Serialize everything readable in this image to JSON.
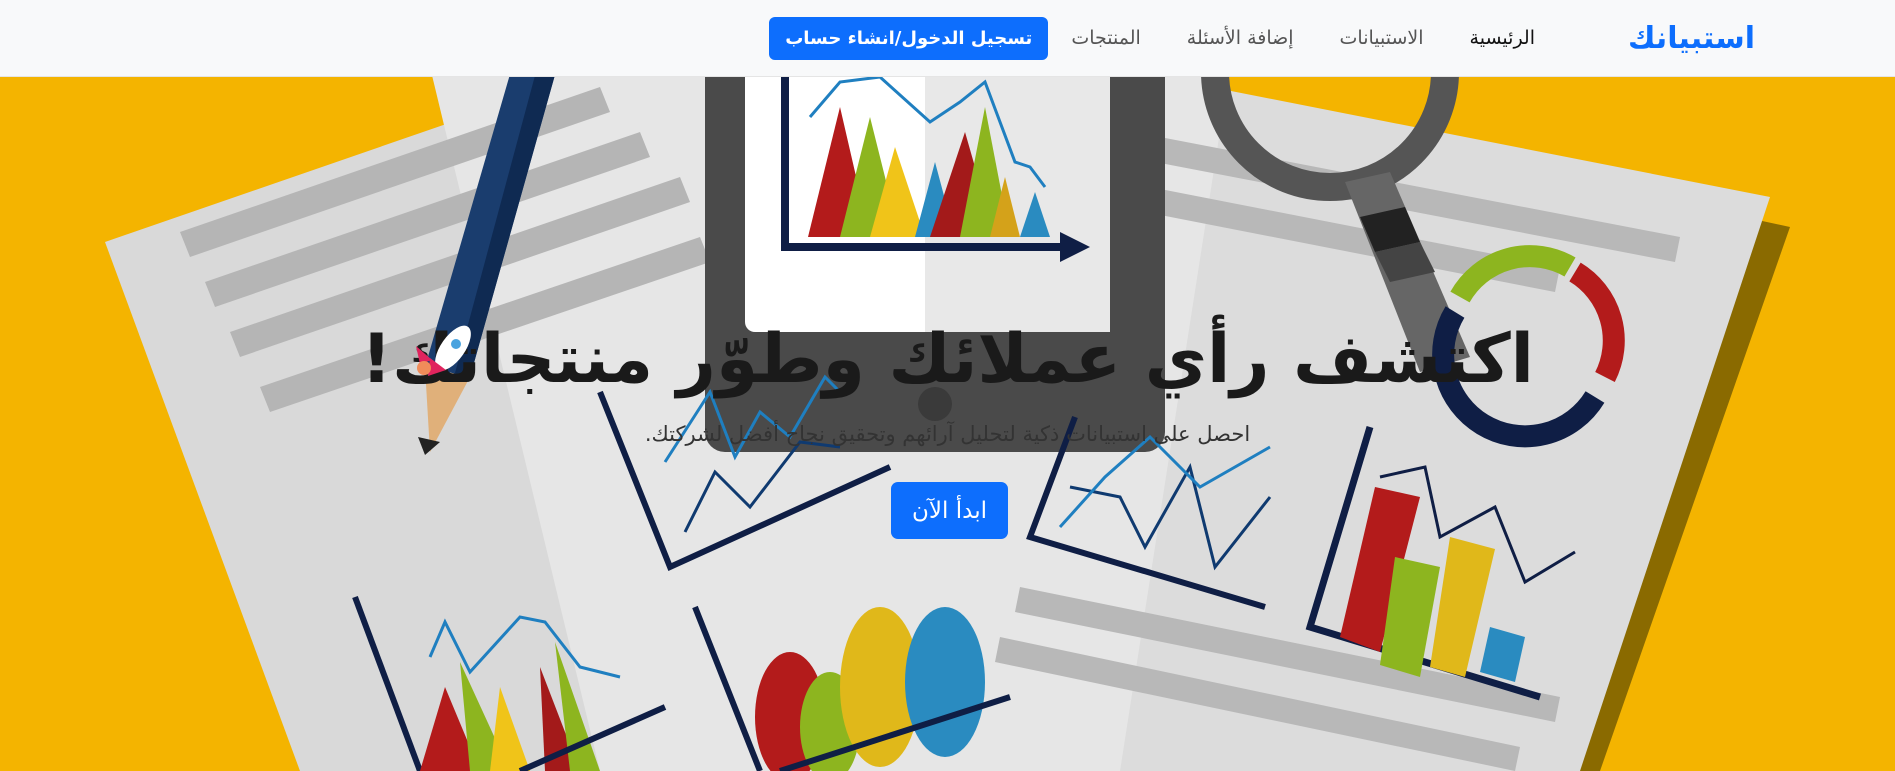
{
  "navbar": {
    "brand": "استبيانك",
    "items": [
      {
        "label": "الرئيسية",
        "active": true
      },
      {
        "label": "الاستبيانات",
        "active": false
      },
      {
        "label": "إضافة الأسئلة",
        "active": false
      },
      {
        "label": "المنتجات",
        "active": false
      }
    ],
    "login_label": "تسجيل الدخول/انشاء حساب"
  },
  "hero": {
    "title": "اكتشف رأي عملائك وطوّر منتجاتك!",
    "subtitle": "احصل على استبيانات ذكية لتحليل آرائهم وتحقيق نجاح أفضل لشركتك.",
    "cta_label": "ابدأ الآن"
  },
  "colors": {
    "accent": "#0d6efd",
    "background": "#f4b400",
    "navbar_bg": "#f8f9fa"
  },
  "icons": [
    "rocket-icon"
  ]
}
